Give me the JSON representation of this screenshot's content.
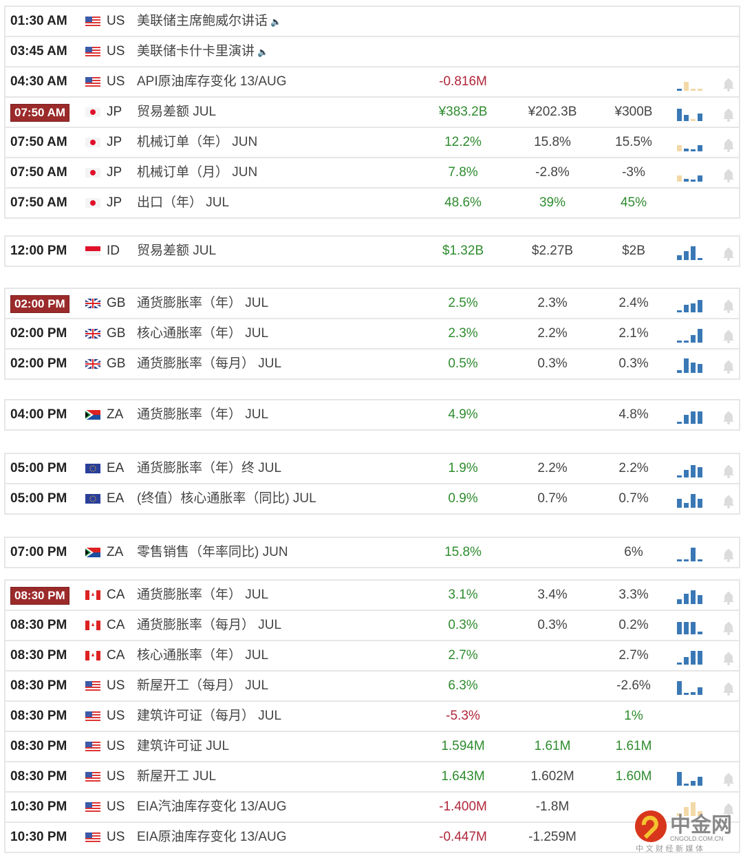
{
  "colors": {
    "positive": "#2e8b2e",
    "negative": "#b0263a",
    "bar_blue": "#3a78b5",
    "bar_tan": "#f3d9a8",
    "highlight": "#9b2a2a"
  },
  "groups": [
    {
      "rows": [
        {
          "time": "01:30 AM",
          "flag": "us",
          "country": "US",
          "event": "美联储主席鲍威尔讲话",
          "speech": true,
          "actual": "",
          "forecast": "",
          "previous": "",
          "bars": [],
          "bell": false
        },
        {
          "time": "03:45 AM",
          "flag": "us",
          "country": "US",
          "event": "美联储卡什卡里演讲",
          "speech": true,
          "actual": "",
          "forecast": "",
          "previous": "",
          "bars": [],
          "bell": false
        },
        {
          "time": "04:30 AM",
          "flag": "us",
          "country": "US",
          "event": "API原油库存变化 13/AUG",
          "actual": "-0.816M",
          "actual_tone": "neg",
          "forecast": "",
          "previous": "",
          "bars": [
            [
              0.15,
              "b"
            ],
            [
              0.6,
              "t"
            ],
            [
              0.1,
              "t"
            ],
            [
              0.1,
              "t"
            ]
          ],
          "bell": true
        },
        {
          "time": "07:50 AM",
          "highlight": true,
          "flag": "jp",
          "country": "JP",
          "event": "贸易差额 JUL",
          "actual": "¥383.2B",
          "actual_tone": "pos",
          "forecast": "¥202.3B",
          "previous": "¥300B",
          "bars": [
            [
              0.8,
              "b"
            ],
            [
              0.4,
              "b"
            ],
            [
              0.15,
              "t"
            ],
            [
              0.5,
              "b"
            ]
          ],
          "bell": true
        },
        {
          "time": "07:50 AM",
          "flag": "jp",
          "country": "JP",
          "event": "机械订单（年） JUN",
          "actual": "12.2%",
          "actual_tone": "pos",
          "forecast": "15.8%",
          "previous": "15.5%",
          "bars": [
            [
              0.4,
              "t"
            ],
            [
              0.2,
              "b"
            ],
            [
              0.1,
              "b"
            ],
            [
              0.4,
              "b"
            ]
          ],
          "bell": true
        },
        {
          "time": "07:50 AM",
          "flag": "jp",
          "country": "JP",
          "event": "机械订单（月） JUN",
          "actual": "7.8%",
          "actual_tone": "pos",
          "forecast": "-2.8%",
          "previous": "-3%",
          "bars": [
            [
              0.4,
              "t"
            ],
            [
              0.2,
              "b"
            ],
            [
              0.1,
              "b"
            ],
            [
              0.4,
              "b"
            ]
          ],
          "bell": true
        },
        {
          "time": "07:50 AM",
          "flag": "jp",
          "country": "JP",
          "event": "出口（年） JUL",
          "actual": "48.6%",
          "actual_tone": "pos",
          "forecast": "39%",
          "forecast_tone": "pos",
          "previous": "45%",
          "previous_tone": "pos",
          "bars": [],
          "bell": false
        }
      ]
    },
    {
      "rows": [
        {
          "time": "12:00 PM",
          "flag": "id",
          "country": "ID",
          "event": "贸易差额 JUL",
          "actual": "$1.32B",
          "actual_tone": "pos",
          "forecast": "$2.27B",
          "previous": "$2B",
          "bars": [
            [
              0.3,
              "b"
            ],
            [
              0.6,
              "b"
            ],
            [
              0.9,
              "b"
            ],
            [
              0.1,
              "b"
            ]
          ],
          "bell": true
        }
      ]
    },
    {
      "rows": [
        {
          "time": "02:00 PM",
          "highlight": true,
          "flag": "gb",
          "country": "GB",
          "event": "通货膨胀率（年） JUL",
          "actual": "2.5%",
          "actual_tone": "pos",
          "forecast": "2.3%",
          "previous": "2.4%",
          "bars": [
            [
              0.1,
              "b"
            ],
            [
              0.5,
              "b"
            ],
            [
              0.6,
              "b"
            ],
            [
              0.8,
              "b"
            ]
          ],
          "bell": true
        },
        {
          "time": "02:00 PM",
          "flag": "gb",
          "country": "GB",
          "event": "核心通胀率（年） JUL",
          "actual": "2.3%",
          "actual_tone": "pos",
          "forecast": "2.2%",
          "previous": "2.1%",
          "bars": [
            [
              0.1,
              "b"
            ],
            [
              0.1,
              "b"
            ],
            [
              0.5,
              "b"
            ],
            [
              0.9,
              "b"
            ]
          ],
          "bell": true
        },
        {
          "time": "02:00 PM",
          "flag": "gb",
          "country": "GB",
          "event": "通货膨胀率（每月） JUL",
          "actual": "0.5%",
          "actual_tone": "pos",
          "forecast": "0.3%",
          "previous": "0.3%",
          "bars": [
            [
              0.2,
              "b"
            ],
            [
              0.95,
              "b"
            ],
            [
              0.7,
              "b"
            ],
            [
              0.6,
              "b"
            ]
          ],
          "bell": true
        }
      ]
    },
    {
      "rows": [
        {
          "time": "04:00 PM",
          "flag": "za",
          "country": "ZA",
          "event": "通货膨胀率（年） JUL",
          "actual": "4.9%",
          "actual_tone": "pos",
          "forecast": "",
          "previous": "4.8%",
          "bars": [
            [
              0.1,
              "b"
            ],
            [
              0.6,
              "b"
            ],
            [
              0.8,
              "b"
            ],
            [
              0.8,
              "b"
            ]
          ],
          "bell": true
        }
      ]
    },
    {
      "rows": [
        {
          "time": "05:00 PM",
          "flag": "ea",
          "country": "EA",
          "event": "通货膨胀率（年）终 JUL",
          "actual": "1.9%",
          "actual_tone": "pos",
          "forecast": "2.2%",
          "previous": "2.2%",
          "bars": [
            [
              0.1,
              "b"
            ],
            [
              0.5,
              "b"
            ],
            [
              0.8,
              "b"
            ],
            [
              0.7,
              "b"
            ]
          ],
          "bell": true
        },
        {
          "time": "05:00 PM",
          "flag": "ea",
          "country": "EA",
          "event": "(终值）核心通胀率（同比) JUL",
          "actual": "0.9%",
          "actual_tone": "pos",
          "forecast": "0.7%",
          "previous": "0.7%",
          "bars": [
            [
              0.6,
              "b"
            ],
            [
              0.3,
              "b"
            ],
            [
              0.9,
              "b"
            ],
            [
              0.6,
              "b"
            ]
          ],
          "bell": true
        }
      ]
    },
    {
      "rows": [
        {
          "time": "07:00 PM",
          "flag": "za",
          "country": "ZA",
          "event": "零售销售（年率同比) JUN",
          "actual": "15.8%",
          "actual_tone": "pos",
          "forecast": "",
          "previous": "6%",
          "bars": [
            [
              0.1,
              "b"
            ],
            [
              0.05,
              "b"
            ],
            [
              0.9,
              "b"
            ],
            [
              0.1,
              "b"
            ]
          ],
          "bell": true
        }
      ]
    },
    {
      "rows": [
        {
          "time": "08:30 PM",
          "highlight": true,
          "flag": "ca",
          "country": "CA",
          "event": "通货膨胀率（年） JUL",
          "actual": "3.1%",
          "actual_tone": "pos",
          "forecast": "3.4%",
          "previous": "3.3%",
          "bars": [
            [
              0.3,
              "b"
            ],
            [
              0.7,
              "b"
            ],
            [
              0.9,
              "b"
            ],
            [
              0.6,
              "b"
            ]
          ],
          "bell": true
        },
        {
          "time": "08:30 PM",
          "flag": "ca",
          "country": "CA",
          "event": "通货膨胀率（每月） JUL",
          "actual": "0.3%",
          "actual_tone": "pos",
          "forecast": "0.3%",
          "previous": "0.2%",
          "bars": [
            [
              0.8,
              "b"
            ],
            [
              0.8,
              "b"
            ],
            [
              0.8,
              "b"
            ],
            [
              0.2,
              "b"
            ]
          ],
          "bell": true
        },
        {
          "time": "08:30 PM",
          "flag": "ca",
          "country": "CA",
          "event": "核心通胀率（年） JUL",
          "actual": "2.7%",
          "actual_tone": "pos",
          "forecast": "",
          "previous": "2.7%",
          "bars": [
            [
              0.1,
              "b"
            ],
            [
              0.5,
              "b"
            ],
            [
              0.9,
              "b"
            ],
            [
              0.9,
              "b"
            ]
          ],
          "bell": true
        },
        {
          "time": "08:30 PM",
          "flag": "us",
          "country": "US",
          "event": "新屋开工（每月） JUL",
          "actual": "6.3%",
          "actual_tone": "pos",
          "forecast": "",
          "previous": "-2.6%",
          "bars": [
            [
              0.9,
              "b"
            ],
            [
              0.1,
              "b"
            ],
            [
              0.2,
              "b"
            ],
            [
              0.5,
              "b"
            ]
          ],
          "bell": true
        },
        {
          "time": "08:30 PM",
          "flag": "us",
          "country": "US",
          "event": "建筑许可证（每月） JUL",
          "actual": "-5.3%",
          "actual_tone": "neg",
          "forecast": "",
          "previous": "1%",
          "previous_tone": "pos",
          "bars": [],
          "bell": false
        },
        {
          "time": "08:30 PM",
          "flag": "us",
          "country": "US",
          "event": "建筑许可证 JUL",
          "actual": "1.594M",
          "actual_tone": "pos",
          "forecast": "1.61M",
          "forecast_tone": "pos",
          "previous": "1.61M",
          "previous_tone": "pos",
          "bars": [],
          "bell": false
        },
        {
          "time": "08:30 PM",
          "flag": "us",
          "country": "US",
          "event": "新屋开工 JUL",
          "actual": "1.643M",
          "actual_tone": "pos",
          "forecast": "1.602M",
          "previous": "1.60M",
          "previous_tone": "pos",
          "bars": [
            [
              0.9,
              "b"
            ],
            [
              0.1,
              "b"
            ],
            [
              0.3,
              "b"
            ],
            [
              0.6,
              "b"
            ]
          ],
          "bell": true
        },
        {
          "time": "10:30 PM",
          "flag": "us",
          "country": "US",
          "event": "EIA汽油库存变化 13/AUG",
          "actual": "-1.400M",
          "actual_tone": "neg",
          "forecast": "-1.8M",
          "previous": "",
          "bars": [
            [
              0.2,
              "t"
            ],
            [
              0.6,
              "t"
            ],
            [
              0.9,
              "t"
            ],
            [
              0.3,
              "t"
            ]
          ],
          "bell": true
        },
        {
          "time": "10:30 PM",
          "flag": "us",
          "country": "US",
          "event": "EIA原油库存变化 13/AUG",
          "actual": "-0.447M",
          "actual_tone": "neg",
          "forecast": "-1.259M",
          "previous": "",
          "bars": [],
          "bell": false
        }
      ]
    }
  ],
  "watermark": {
    "name": "中金网",
    "domain": "CNGOLD.COM.CN",
    "tagline": "中 文 财 经 新 媒 体"
  }
}
